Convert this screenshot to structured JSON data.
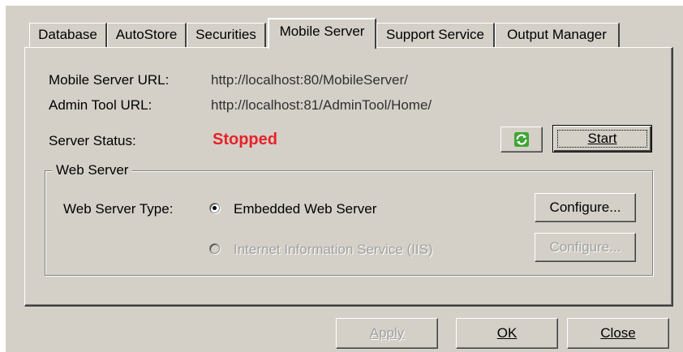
{
  "tabs": [
    {
      "label": "Database",
      "active": false
    },
    {
      "label": "AutoStore",
      "active": false
    },
    {
      "label": "Securities",
      "active": false
    },
    {
      "label": "Mobile Server",
      "active": true
    },
    {
      "label": "Support Service",
      "active": false
    },
    {
      "label": "Output Manager",
      "active": false
    }
  ],
  "server_info": {
    "mobile_url_label": "Mobile Server URL:",
    "mobile_url_value": "http://localhost:80/MobileServer/",
    "admin_url_label": "Admin Tool URL:",
    "admin_url_value": "http://localhost:81/AdminTool/Home/",
    "status_label": "Server Status:",
    "status_value": "Stopped",
    "status_color": "#e8212a",
    "refresh_icon": "refresh-icon",
    "start_button": "Start"
  },
  "web_server": {
    "group_title": "Web Server",
    "type_label": "Web Server Type:",
    "options": [
      {
        "label": "Embedded Web Server",
        "selected": true,
        "enabled": true,
        "configure": "Configure..."
      },
      {
        "label": "Internet Information Service (IIS)",
        "selected": false,
        "enabled": false,
        "configure": "Configure..."
      }
    ]
  },
  "footer": {
    "apply": "Apply",
    "ok": "OK",
    "close": "Close"
  }
}
